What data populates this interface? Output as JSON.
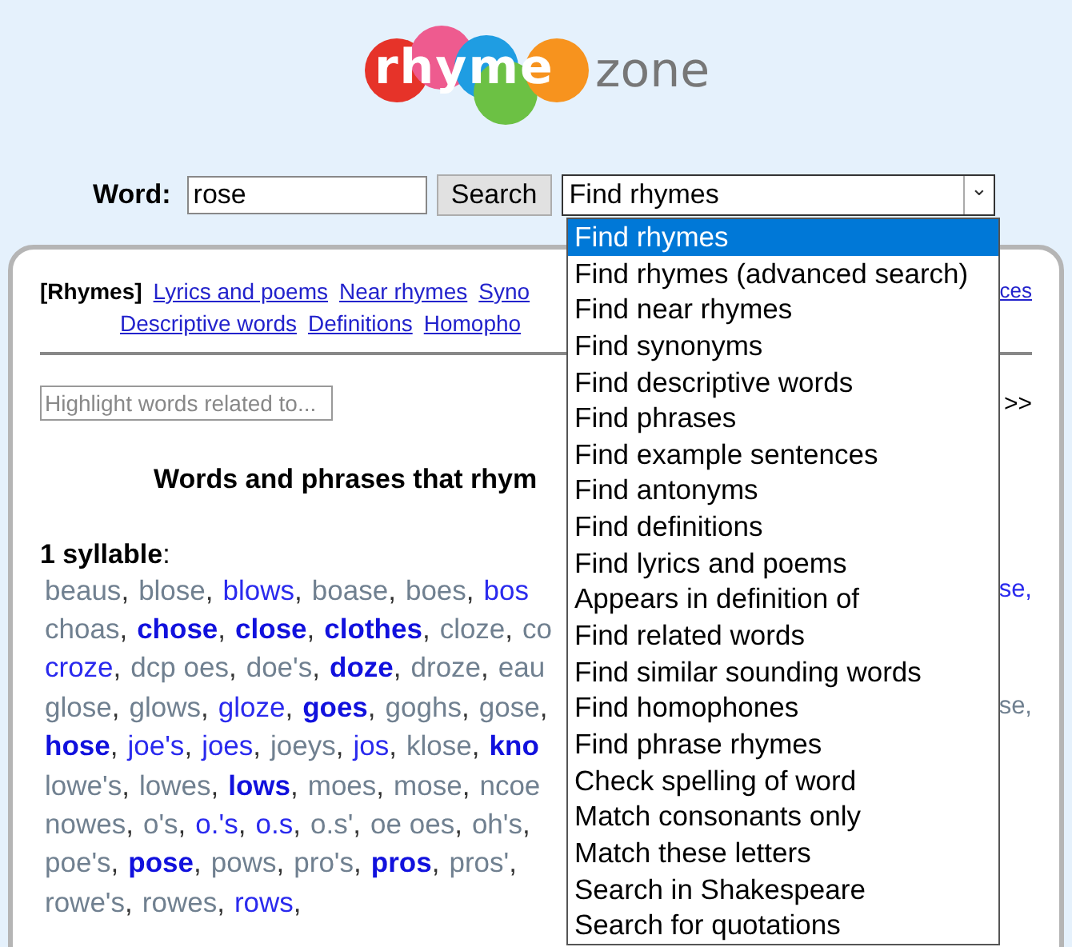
{
  "logo": {
    "part1": "rhyme",
    "part2": "zone"
  },
  "search": {
    "label": "Word:",
    "value": "rose",
    "button": "Search",
    "select_value": "Find rhymes",
    "arrow": "⌄"
  },
  "dropdown": [
    {
      "label": "Find rhymes",
      "selected": true
    },
    {
      "label": "Find rhymes (advanced search)",
      "selected": false
    },
    {
      "label": "Find near rhymes",
      "selected": false
    },
    {
      "label": "Find synonyms",
      "selected": false
    },
    {
      "label": "Find descriptive words",
      "selected": false
    },
    {
      "label": "Find phrases",
      "selected": false
    },
    {
      "label": "Find example sentences",
      "selected": false
    },
    {
      "label": "Find antonyms",
      "selected": false
    },
    {
      "label": "Find definitions",
      "selected": false
    },
    {
      "label": "Find lyrics and poems",
      "selected": false
    },
    {
      "label": "Appears in definition of",
      "selected": false
    },
    {
      "label": "Find related words",
      "selected": false
    },
    {
      "label": "Find similar sounding words",
      "selected": false
    },
    {
      "label": "Find homophones",
      "selected": false
    },
    {
      "label": "Find phrase rhymes",
      "selected": false
    },
    {
      "label": "Check spelling of word",
      "selected": false
    },
    {
      "label": "Match consonants only",
      "selected": false
    },
    {
      "label": "Match these letters",
      "selected": false
    },
    {
      "label": "Search in Shakespeare",
      "selected": false
    },
    {
      "label": "Search for quotations",
      "selected": false
    }
  ],
  "nav": [
    [
      {
        "label": "[Rhymes]",
        "selected": true
      },
      {
        "label": "Lyrics and poems",
        "selected": false
      },
      {
        "label": "Near rhymes",
        "selected": false
      },
      {
        "label": "Syno",
        "selected": false
      }
    ],
    [
      {
        "label": "Descriptive words",
        "selected": false
      },
      {
        "label": "Definitions",
        "selected": false
      },
      {
        "label": "Homopho",
        "selected": false
      }
    ]
  ],
  "nav_right_fragment": "ces",
  "highlight": {
    "placeholder": "Highlight words related to..."
  },
  "more_fragment": ">>",
  "heading": "Words and phrases that rhym",
  "section": {
    "title": "1 syllable",
    "colon": ":"
  },
  "rows": [
    {
      "right": {
        "text": "se,",
        "kind": "common"
      },
      "words": [
        {
          "text": "beaus",
          "kind": "rare",
          "sep": ","
        },
        {
          "text": "blose",
          "kind": "rare",
          "sep": ","
        },
        {
          "text": "blows",
          "kind": "common",
          "sep": ","
        },
        {
          "text": "boase",
          "kind": "rare",
          "sep": ","
        },
        {
          "text": "boes",
          "kind": "rare",
          "sep": ","
        },
        {
          "text": "bos",
          "kind": "common"
        }
      ]
    },
    {
      "words": [
        {
          "text": "choas",
          "kind": "rare",
          "sep": ","
        },
        {
          "text": "chose",
          "kind": "popular",
          "sep": ","
        },
        {
          "text": "close",
          "kind": "popular",
          "sep": ","
        },
        {
          "text": "clothes",
          "kind": "popular",
          "sep": ","
        },
        {
          "text": "cloze",
          "kind": "rare",
          "sep": ","
        },
        {
          "text": "co",
          "kind": "rare"
        }
      ]
    },
    {
      "words": [
        {
          "text": "croze",
          "kind": "common",
          "sep": ","
        },
        {
          "text": "dcp oes",
          "kind": "rare",
          "sep": ","
        },
        {
          "text": "doe's",
          "kind": "rare",
          "sep": ","
        },
        {
          "text": "doze",
          "kind": "popular",
          "sep": ","
        },
        {
          "text": "droze",
          "kind": "rare",
          "sep": ","
        },
        {
          "text": "eau",
          "kind": "rare"
        }
      ]
    },
    {
      "right": {
        "text": "se,",
        "kind": "rare"
      },
      "words": [
        {
          "text": "glose",
          "kind": "rare",
          "sep": ","
        },
        {
          "text": "glows",
          "kind": "rare",
          "sep": ","
        },
        {
          "text": "gloze",
          "kind": "common",
          "sep": ","
        },
        {
          "text": "goes",
          "kind": "popular",
          "sep": ","
        },
        {
          "text": "goghs",
          "kind": "rare",
          "sep": ","
        },
        {
          "text": "gose",
          "kind": "rare",
          "sep": ","
        }
      ]
    },
    {
      "words": [
        {
          "text": "hose",
          "kind": "popular",
          "sep": ","
        },
        {
          "text": "joe's",
          "kind": "common",
          "sep": ","
        },
        {
          "text": "joes",
          "kind": "common",
          "sep": ","
        },
        {
          "text": "joeys",
          "kind": "rare",
          "sep": ","
        },
        {
          "text": "jos",
          "kind": "common",
          "sep": ","
        },
        {
          "text": "klose",
          "kind": "rare",
          "sep": ","
        },
        {
          "text": "kno",
          "kind": "popular"
        }
      ]
    },
    {
      "words": [
        {
          "text": "lowe's",
          "kind": "rare",
          "sep": ","
        },
        {
          "text": "lowes",
          "kind": "rare",
          "sep": ","
        },
        {
          "text": "lows",
          "kind": "popular",
          "sep": ","
        },
        {
          "text": "moes",
          "kind": "rare",
          "sep": ","
        },
        {
          "text": "mose",
          "kind": "rare",
          "sep": ","
        },
        {
          "text": "ncoe",
          "kind": "rare"
        }
      ]
    },
    {
      "words": [
        {
          "text": "nowes",
          "kind": "rare",
          "sep": ","
        },
        {
          "text": "o's",
          "kind": "rare",
          "sep": ","
        },
        {
          "text": "o.'s",
          "kind": "common",
          "sep": ","
        },
        {
          "text": "o.s",
          "kind": "common",
          "sep": ","
        },
        {
          "text": "o.s'",
          "kind": "rare",
          "sep": ","
        },
        {
          "text": "oe oes",
          "kind": "rare",
          "sep": ","
        },
        {
          "text": "oh's",
          "kind": "rare",
          "sep": ","
        }
      ]
    },
    {
      "words": [
        {
          "text": "poe's",
          "kind": "rare",
          "sep": ","
        },
        {
          "text": "pose",
          "kind": "popular",
          "sep": ","
        },
        {
          "text": "pows",
          "kind": "rare",
          "sep": ","
        },
        {
          "text": "pro's",
          "kind": "rare",
          "sep": ","
        },
        {
          "text": "pros",
          "kind": "popular",
          "sep": ","
        },
        {
          "text": "pros'",
          "kind": "rare",
          "sep": ","
        }
      ]
    },
    {
      "words": [
        {
          "text": "rowe's",
          "kind": "rare",
          "sep": ","
        },
        {
          "text": "rowes",
          "kind": "rare",
          "sep": ","
        },
        {
          "text": "rows",
          "kind": "common",
          "sep": ","
        }
      ]
    }
  ]
}
